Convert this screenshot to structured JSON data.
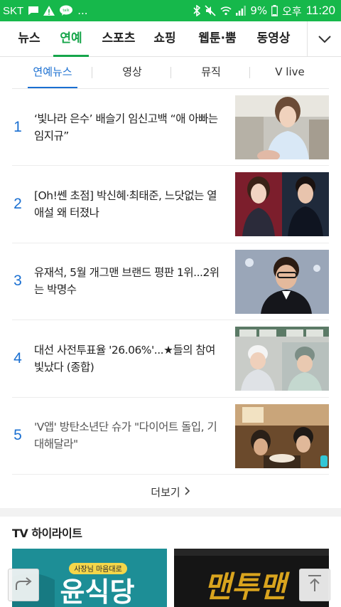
{
  "status_bar": {
    "carrier": "SKT",
    "battery": "9%",
    "ampm": "오후",
    "time": "11:20",
    "more_indicator": "...",
    "icons": [
      "message-icon",
      "warning-icon",
      "talk-icon",
      "bluetooth-icon",
      "mute-icon",
      "wifi-icon",
      "signal-icon",
      "battery-icon"
    ]
  },
  "main_tabs": [
    {
      "label": "뉴스",
      "active": false
    },
    {
      "label": "연예",
      "active": true
    },
    {
      "label": "스포츠",
      "active": false
    },
    {
      "label": "쇼핑",
      "active": false
    },
    {
      "label": "웹툰·뿜",
      "active": false
    },
    {
      "label": "동영상",
      "active": false
    }
  ],
  "sub_tabs": [
    {
      "label": "연예뉴스",
      "active": true
    },
    {
      "label": "영상",
      "active": false
    },
    {
      "label": "뮤직",
      "active": false
    },
    {
      "label": "V live",
      "active": false
    }
  ],
  "news": [
    {
      "rank": "1",
      "line1": "‘빛나라 은수’ 배슬기 임신고백 “애 아빠는",
      "line2": "임지규”",
      "visited": false
    },
    {
      "rank": "2",
      "line1": "[Oh!쎈 초점] 박신혜·최태준, 느닷없는 열",
      "line2": "애설 왜 터졌나",
      "visited": false
    },
    {
      "rank": "3",
      "line1": "유재석, 5월 개그맨 브랜드 평판 1위...2위",
      "line2": "는 박명수",
      "visited": false
    },
    {
      "rank": "4",
      "line1": "대선 사전투표율 '26.06%'...★들의 참여",
      "line2": "빛났다 (종합)",
      "visited": false
    },
    {
      "rank": "5",
      "line1": "'V앱' 방탄소년단 슈가 \"다이어트 돌입, 기",
      "line2": "대해달라\"",
      "visited": true
    }
  ],
  "more_label": "더보기",
  "tv_section": {
    "title": "TV 하이라이트",
    "cards": [
      {
        "logo": "윤식당",
        "tag": "사장님 마음대로",
        "bg": "#1d8e96"
      },
      {
        "logo": "맨투맨",
        "bg": "#151515"
      }
    ]
  },
  "colors": {
    "brand_green": "#16b84b",
    "active_tab": "#16a54a",
    "link_blue": "#1a6fd1"
  }
}
